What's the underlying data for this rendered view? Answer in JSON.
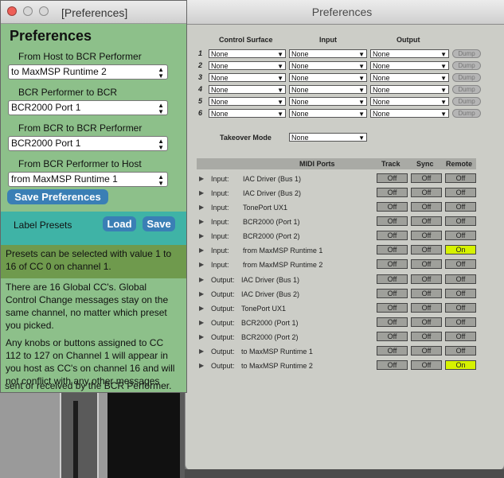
{
  "max_window": {
    "title": "[Preferences]",
    "heading": "Preferences",
    "sections": [
      {
        "label": "From Host to BCR Performer",
        "value": "to MaxMSP Runtime 2"
      },
      {
        "label": "BCR Performer to BCR",
        "value": "BCR2000 Port 1"
      },
      {
        "label": "From BCR to BCR Performer",
        "value": "BCR2000 Port 1"
      },
      {
        "label": "From BCR Performer to Host",
        "value": "from MaxMSP Runtime 1"
      }
    ],
    "save_preferences": "Save Preferences",
    "label_presets": "Label Presets",
    "load": "Load",
    "save": "Save",
    "preset_info": [
      "Presets can be selected with value 1 to",
      "16 of CC 0 on channel 1."
    ],
    "global_info": [
      "There are 16 Global CC's. Global",
      "Control Change messages stay on the",
      "same channel, no matter which preset",
      "you picked."
    ],
    "knob_info": [
      "Any knobs or buttons assigned to CC",
      "112 to 127 on Channel 1 will appear in",
      "you host as CC's on channel 16 and will",
      "not conflict with any other messages",
      "sent or received by the BCR Performer."
    ]
  },
  "live_window": {
    "title": "Preferences",
    "headers": {
      "control_surface": "Control Surface",
      "input": "Input",
      "output": "Output"
    },
    "surface_rows": [
      {
        "num": "1",
        "cs": "None",
        "in": "None",
        "out": "None",
        "dump": "Dump"
      },
      {
        "num": "2",
        "cs": "None",
        "in": "None",
        "out": "None",
        "dump": "Dump"
      },
      {
        "num": "3",
        "cs": "None",
        "in": "None",
        "out": "None",
        "dump": "Dump"
      },
      {
        "num": "4",
        "cs": "None",
        "in": "None",
        "out": "None",
        "dump": "Dump"
      },
      {
        "num": "5",
        "cs": "None",
        "in": "None",
        "out": "None",
        "dump": "Dump"
      },
      {
        "num": "6",
        "cs": "None",
        "in": "None",
        "out": "None",
        "dump": "Dump"
      }
    ],
    "takeover_label": "Takeover Mode",
    "takeover_value": "None",
    "midi_headers": {
      "ports": "MIDI Ports",
      "track": "Track",
      "sync": "Sync",
      "remote": "Remote"
    },
    "midi_rows": [
      {
        "dir": "Input:",
        "name": "IAC Driver (Bus 1)",
        "track": "Off",
        "sync": "Off",
        "remote": "Off"
      },
      {
        "dir": "Input:",
        "name": "IAC Driver (Bus 2)",
        "track": "Off",
        "sync": "Off",
        "remote": "Off"
      },
      {
        "dir": "Input:",
        "name": "TonePort UX1",
        "track": "Off",
        "sync": "Off",
        "remote": "Off"
      },
      {
        "dir": "Input:",
        "name": "BCR2000 (Port 1)",
        "track": "Off",
        "sync": "Off",
        "remote": "Off"
      },
      {
        "dir": "Input:",
        "name": "BCR2000 (Port 2)",
        "track": "Off",
        "sync": "Off",
        "remote": "Off"
      },
      {
        "dir": "Input:",
        "name": "from MaxMSP Runtime 1",
        "track": "Off",
        "sync": "Off",
        "remote": "On"
      },
      {
        "dir": "Input:",
        "name": "from MaxMSP Runtime 2",
        "track": "Off",
        "sync": "Off",
        "remote": "Off"
      },
      {
        "dir": "Output:",
        "name": "IAC Driver (Bus 1)",
        "track": "Off",
        "sync": "Off",
        "remote": "Off"
      },
      {
        "dir": "Output:",
        "name": "IAC Driver (Bus 2)",
        "track": "Off",
        "sync": "Off",
        "remote": "Off"
      },
      {
        "dir": "Output:",
        "name": "TonePort UX1",
        "track": "Off",
        "sync": "Off",
        "remote": "Off"
      },
      {
        "dir": "Output:",
        "name": "BCR2000 (Port 1)",
        "track": "Off",
        "sync": "Off",
        "remote": "Off"
      },
      {
        "dir": "Output:",
        "name": "BCR2000 (Port 2)",
        "track": "Off",
        "sync": "Off",
        "remote": "Off"
      },
      {
        "dir": "Output:",
        "name": "to MaxMSP Runtime 1",
        "track": "Off",
        "sync": "Off",
        "remote": "Off"
      },
      {
        "dir": "Output:",
        "name": "to MaxMSP Runtime 2",
        "track": "Off",
        "sync": "Off",
        "remote": "On"
      }
    ]
  },
  "colors": {
    "max_panel": "#8dc08a",
    "teal_band": "#3fb3a6",
    "olive_band": "#6f9a4d",
    "on_button": "#d6f200",
    "save_button": "#3a7fb5"
  }
}
